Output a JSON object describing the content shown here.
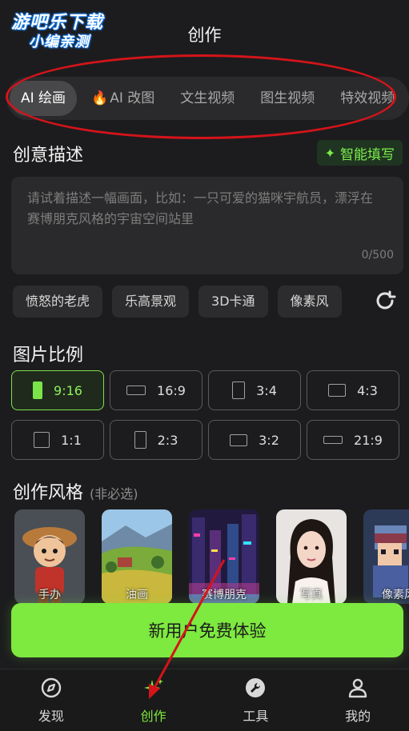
{
  "watermark": {
    "line1": "游吧乐下载",
    "line2": "小编亲测"
  },
  "header": {
    "title": "创作"
  },
  "tabs": [
    {
      "label": "AI 绘画",
      "active": true
    },
    {
      "label": "AI 改图",
      "flame": "🔥"
    },
    {
      "label": "文生视频"
    },
    {
      "label": "图生视频"
    },
    {
      "label": "特效视频"
    }
  ],
  "description": {
    "title": "创意描述",
    "smart_fill_label": "智能填写",
    "placeholder": "请试着描述一幅画面，比如：一只可爱的猫咪宇航员，漂浮在赛博朋克风格的宇宙空间站里",
    "counter": "0/500",
    "suggestions": [
      "愤怒的老虎",
      "乐高景观",
      "3D卡通",
      "像素风"
    ]
  },
  "ratio": {
    "title": "图片比例",
    "options": [
      {
        "label": "9:16",
        "active": true
      },
      {
        "label": "16:9"
      },
      {
        "label": "3:4"
      },
      {
        "label": "4:3"
      },
      {
        "label": "1:1"
      },
      {
        "label": "2:3"
      },
      {
        "label": "3:2"
      },
      {
        "label": "21:9"
      }
    ]
  },
  "styles": {
    "title": "创作风格",
    "subtitle": "(非必选)",
    "items": [
      "手办",
      "油画",
      "赛博朋克",
      "写真",
      "像素风"
    ]
  },
  "cta": {
    "label": "新用户免费体验"
  },
  "nav": [
    {
      "label": "发现",
      "icon": "compass-icon"
    },
    {
      "label": "创作",
      "icon": "sparkle-icon",
      "active": true
    },
    {
      "label": "工具",
      "icon": "wrench-icon"
    },
    {
      "label": "我的",
      "icon": "user-icon"
    }
  ],
  "colors": {
    "accent": "#7ee93f",
    "annotation": "#d4141a",
    "background": "#1c1c1e"
  }
}
